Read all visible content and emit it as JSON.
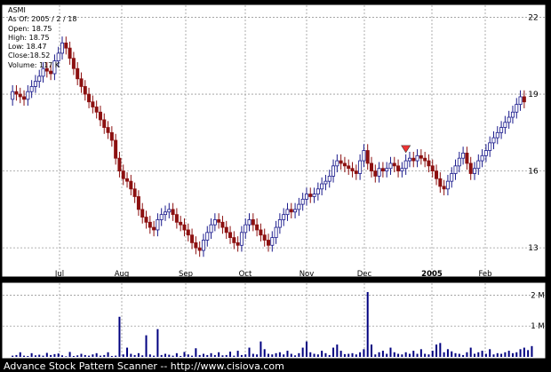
{
  "info": {
    "symbol": "ASMI",
    "as_of": "As Of: 2005 / 2 / 18",
    "open": "Open: 18.75",
    "high": "High: 18.75",
    "low": "Low: 18.47",
    "close": "Close:18.52",
    "volume": "Volume: 117 K"
  },
  "footer": "Advance Stock Pattern Scanner -- http://www.cisiova.com",
  "colors": {
    "background": "#ffffff",
    "frame": "#000000",
    "grid": "#9a9a9a",
    "up_candle": "#1a1a8c",
    "down_candle": "#8c1010",
    "volume_bar": "#000080",
    "marker": "#ee3333"
  },
  "chart_data": [
    {
      "type": "candlestick",
      "title": "",
      "x_tick_labels": [
        "Jul",
        "Aug",
        "Sep",
        "Oct",
        "Nov",
        "Dec",
        "2005",
        "Feb"
      ],
      "y_ticks": [
        13,
        16,
        19,
        22
      ],
      "ylim": [
        12.0,
        22.4
      ],
      "grid": true,
      "series": [
        {
          "name": "",
          "close": [
            19.1,
            19.0,
            18.9,
            18.8,
            19.1,
            19.3,
            19.5,
            19.7,
            20.0,
            19.9,
            19.8,
            20.3,
            20.6,
            21.0,
            20.8,
            20.4,
            20.0,
            19.6,
            19.3,
            19.0,
            18.7,
            18.5,
            18.3,
            18.0,
            17.7,
            17.5,
            17.2,
            16.5,
            16.0,
            15.7,
            15.6,
            15.3,
            15.0,
            14.5,
            14.2,
            14.0,
            13.8,
            13.7,
            14.1,
            14.3,
            14.4,
            14.5,
            14.3,
            14.0,
            13.9,
            13.7,
            13.5,
            13.2,
            13.0,
            12.9,
            13.3,
            13.6,
            13.9,
            14.1,
            14.0,
            13.8,
            13.6,
            13.4,
            13.2,
            13.1,
            13.6,
            13.9,
            14.1,
            13.9,
            13.7,
            13.5,
            13.3,
            13.1,
            13.4,
            13.8,
            14.1,
            14.3,
            14.5,
            14.4,
            14.5,
            14.7,
            14.9,
            15.1,
            15.0,
            15.1,
            15.3,
            15.5,
            15.6,
            15.8,
            16.2,
            16.4,
            16.3,
            16.2,
            16.1,
            16.0,
            15.9,
            16.4,
            16.8,
            16.3,
            16.0,
            15.8,
            16.1,
            16.0,
            16.1,
            16.3,
            16.2,
            16.0,
            16.1,
            16.4,
            16.5,
            16.4,
            16.6,
            16.5,
            16.4,
            16.2,
            16.0,
            15.7,
            15.4,
            15.3,
            15.6,
            15.9,
            16.2,
            16.5,
            16.7,
            16.3,
            15.9,
            16.1,
            16.4,
            16.6,
            16.8,
            17.1,
            17.3,
            17.5,
            17.7,
            17.9,
            18.1,
            18.3,
            18.6,
            18.9,
            18.7
          ],
          "open": [
            18.8,
            19.1,
            19.0,
            18.9,
            18.8,
            19.1,
            19.3,
            19.5,
            19.7,
            20.0,
            19.9,
            19.8,
            20.3,
            20.6,
            21.0,
            20.8,
            20.4,
            20.0,
            19.6,
            19.3,
            19.0,
            18.7,
            18.5,
            18.3,
            18.0,
            17.7,
            17.5,
            17.2,
            16.5,
            16.0,
            15.7,
            15.6,
            15.3,
            15.0,
            14.5,
            14.2,
            14.0,
            13.8,
            13.7,
            14.1,
            14.3,
            14.4,
            14.5,
            14.3,
            14.0,
            13.9,
            13.7,
            13.5,
            13.2,
            13.0,
            12.9,
            13.3,
            13.6,
            13.9,
            14.1,
            14.0,
            13.8,
            13.6,
            13.4,
            13.2,
            13.1,
            13.6,
            13.9,
            14.1,
            13.9,
            13.7,
            13.5,
            13.3,
            13.1,
            13.4,
            13.8,
            14.1,
            14.3,
            14.5,
            14.4,
            14.5,
            14.7,
            14.9,
            15.1,
            15.0,
            15.1,
            15.3,
            15.5,
            15.6,
            15.8,
            16.2,
            16.4,
            16.3,
            16.2,
            16.1,
            16.0,
            15.9,
            16.4,
            16.8,
            16.3,
            16.0,
            15.8,
            16.1,
            16.0,
            16.1,
            16.3,
            16.2,
            16.0,
            16.1,
            16.4,
            16.5,
            16.4,
            16.6,
            16.5,
            16.4,
            16.2,
            16.0,
            15.7,
            15.4,
            15.3,
            15.6,
            15.9,
            16.2,
            16.5,
            16.7,
            16.3,
            15.9,
            16.1,
            16.4,
            16.6,
            16.8,
            17.1,
            17.3,
            17.5,
            17.7,
            17.9,
            18.1,
            18.3,
            18.6,
            18.9
          ]
        }
      ],
      "pattern_markers": [
        103,
        138,
        145,
        148
      ],
      "volume": {
        "y_ticks_labels": [
          "1 M",
          "2 M"
        ],
        "y_ticks": [
          1000000,
          2000000
        ],
        "ylim": [
          0,
          2300000
        ],
        "values": [
          40000,
          60000,
          150000,
          40000,
          30000,
          120000,
          50000,
          70000,
          40000,
          130000,
          60000,
          90000,
          110000,
          50000,
          20000,
          160000,
          30000,
          50000,
          100000,
          60000,
          40000,
          80000,
          120000,
          40000,
          60000,
          150000,
          30000,
          40000,
          1300000,
          80000,
          300000,
          100000,
          60000,
          120000,
          50000,
          700000,
          80000,
          40000,
          900000,
          60000,
          100000,
          70000,
          40000,
          120000,
          30000,
          160000,
          80000,
          40000,
          280000,
          60000,
          100000,
          60000,
          120000,
          60000,
          150000,
          50000,
          60000,
          170000,
          40000,
          200000,
          60000,
          80000,
          300000,
          100000,
          80000,
          500000,
          250000,
          100000,
          80000,
          120000,
          150000,
          80000,
          200000,
          100000,
          50000,
          120000,
          300000,
          500000,
          150000,
          100000,
          80000,
          200000,
          120000,
          60000,
          300000,
          400000,
          200000,
          90000,
          100000,
          120000,
          80000,
          150000,
          250000,
          2100000,
          400000,
          80000,
          150000,
          200000,
          100000,
          300000,
          150000,
          100000,
          80000,
          150000,
          100000,
          200000,
          100000,
          250000,
          100000,
          80000,
          200000,
          400000,
          450000,
          150000,
          250000,
          180000,
          120000,
          100000,
          60000,
          150000,
          300000,
          100000,
          150000,
          200000,
          100000,
          250000,
          80000,
          120000,
          100000,
          150000,
          200000,
          120000,
          150000,
          250000,
          300000,
          220000,
          350000
        ]
      }
    }
  ]
}
